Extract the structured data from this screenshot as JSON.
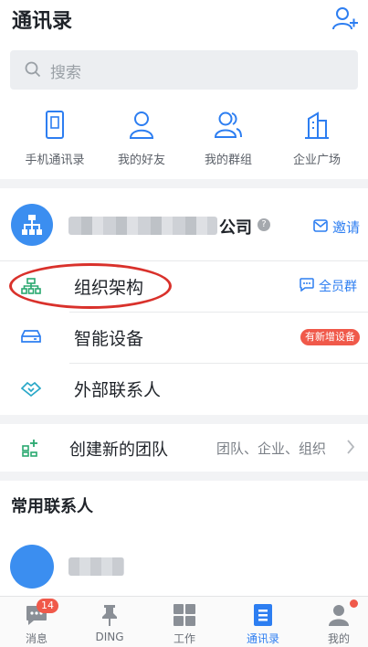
{
  "header": {
    "title": "通讯录",
    "add_contact_icon": "add-person-icon"
  },
  "search": {
    "placeholder": "搜索",
    "icon": "search-icon"
  },
  "quick_links": [
    {
      "label": "手机通讯录",
      "icon": "phone-icon"
    },
    {
      "label": "我的好友",
      "icon": "person-icon"
    },
    {
      "label": "我的群组",
      "icon": "group-icon"
    },
    {
      "label": "企业广场",
      "icon": "building-icon"
    }
  ],
  "organization": {
    "name_suffix": "公司",
    "invite_label": "邀请",
    "rows": [
      {
        "label": "组织架构",
        "icon": "org-chart-icon",
        "action_label": "全员群"
      },
      {
        "label": "智能设备",
        "icon": "device-icon",
        "badge": "有新增设备"
      },
      {
        "label": "外部联系人",
        "icon": "handshake-icon"
      }
    ]
  },
  "team": {
    "label": "创建新的团队",
    "hint": "团队、企业、组织"
  },
  "common_contacts": {
    "title": "常用联系人"
  },
  "tabbar": [
    {
      "label": "消息",
      "icon": "message-icon",
      "badge": "14"
    },
    {
      "label": "DING",
      "icon": "pin-icon"
    },
    {
      "label": "工作",
      "icon": "grid-icon"
    },
    {
      "label": "通讯录",
      "icon": "contacts-icon",
      "active": true
    },
    {
      "label": "我的",
      "icon": "profile-icon",
      "dot": true
    }
  ],
  "colors": {
    "accent": "#2d7ef1",
    "badge": "#f0594a",
    "annotation": "#d9312b",
    "green": "#2aa870"
  }
}
